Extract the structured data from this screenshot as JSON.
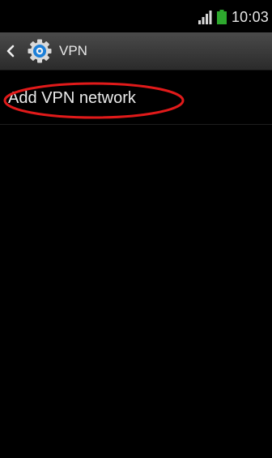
{
  "status_bar": {
    "time": "10:03",
    "icons": [
      "signal-icon",
      "battery-icon"
    ],
    "battery_color": "#2ea82e"
  },
  "action_bar": {
    "title": "VPN",
    "icons": [
      "back-icon",
      "settings-gear-icon"
    ],
    "gear_color": "#1c7fd8"
  },
  "list": {
    "items": [
      {
        "label": "Add VPN network"
      }
    ]
  },
  "annotation": {
    "color": "#e11a1a",
    "shape": "ellipse",
    "target": "Add VPN network"
  }
}
